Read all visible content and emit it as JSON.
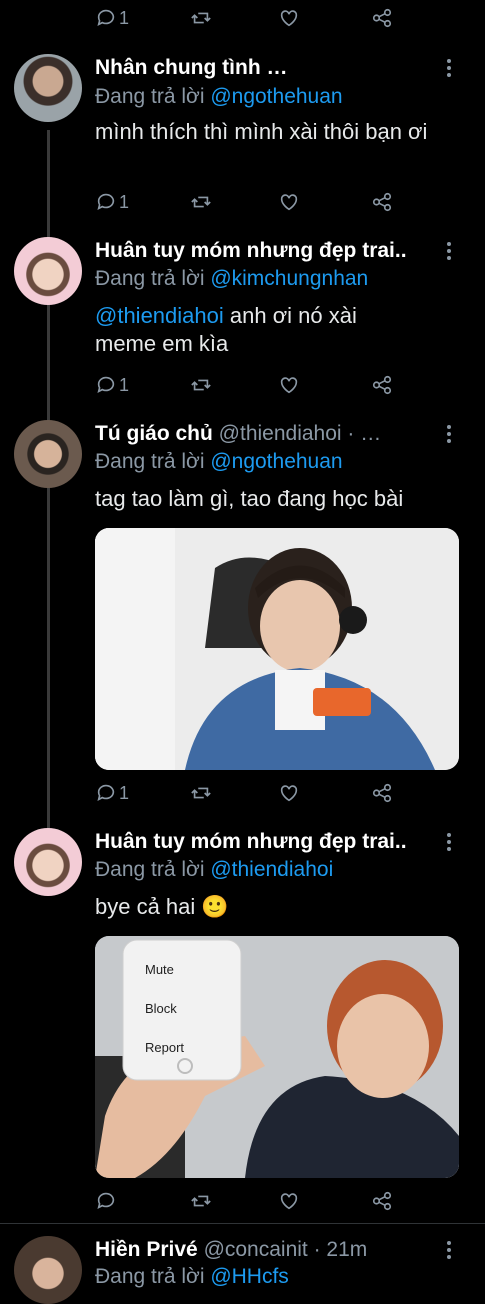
{
  "colors": {
    "background": "#000000",
    "link": "#1d9bf0",
    "muted": "#8b98a5",
    "text": "#e7e9ea",
    "divider": "#2f3336"
  },
  "top_actions": {
    "reply_count": "1"
  },
  "tweets": [
    {
      "name": "Nhân chung tình …",
      "handle": "",
      "reply_prefix": "Đang trả lời",
      "reply_to": "@ngothehuan",
      "text": "mình thích thì mình xài thôi bạn ơi",
      "mention": "",
      "reply_count": "1",
      "avatar": "avatar-photo"
    },
    {
      "name": "Huân tuy móm nhưng đẹp trai..",
      "handle": "",
      "reply_prefix": "Đang trả lời",
      "reply_to": "@kimchungnhan",
      "mention": "@thiendiahoi",
      "text": " anh ơi nó xài meme em kìa",
      "reply_count": "1",
      "avatar": "avatar-photo"
    },
    {
      "name": "Tú giáo chủ",
      "handle": "@thiendiahoi · …",
      "reply_prefix": "Đang trả lời",
      "reply_to": "@ngothehuan",
      "text": "tag tao làm gì, tao đang học bài",
      "mention": "",
      "reply_count": "1",
      "avatar": "avatar-photo",
      "media": "photo-headset"
    },
    {
      "name": "Huân tuy móm nhưng đẹp trai..",
      "handle": "",
      "reply_prefix": "Đang trả lời",
      "reply_to": "@thiendiahoi",
      "text": "bye cả hai 🙂",
      "mention": "",
      "reply_count": "",
      "avatar": "avatar-photo",
      "media": "photo-phone-menu",
      "media_menu": [
        "Mute",
        "Block",
        "Report"
      ]
    },
    {
      "name": "Hiền Privé",
      "handle": "@concainit · 21m",
      "reply_prefix": "Đang trả lời",
      "reply_to": "@HHcfs",
      "text": "",
      "mention": "",
      "avatar": "avatar-photo"
    }
  ]
}
